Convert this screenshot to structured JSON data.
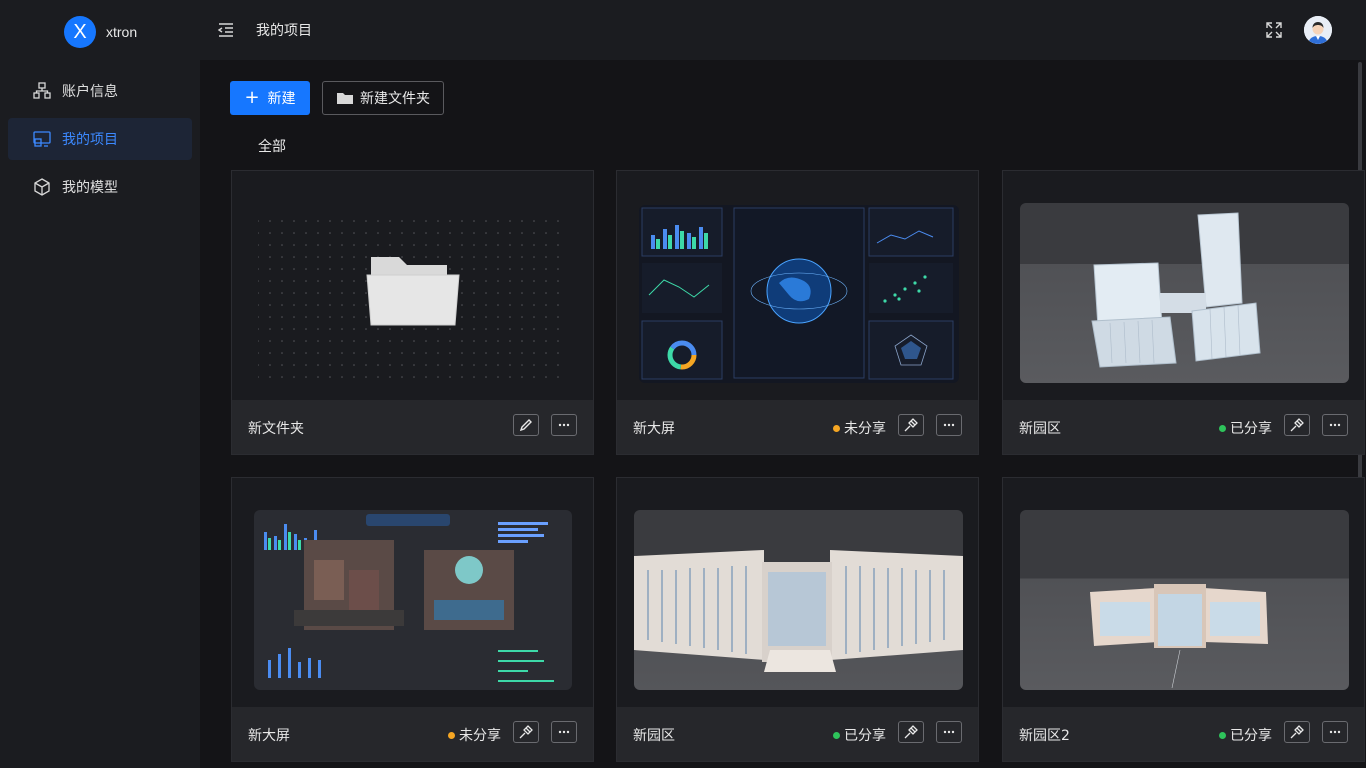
{
  "app": {
    "logo_letter": "X",
    "name": "xtron"
  },
  "sidebar": {
    "items": [
      {
        "label": "账户信息",
        "icon": "account-tree-icon",
        "active": false
      },
      {
        "label": "我的项目",
        "icon": "project-screen-icon",
        "active": true
      },
      {
        "label": "我的模型",
        "icon": "cube-icon",
        "active": false
      }
    ]
  },
  "header": {
    "title": "我的项目"
  },
  "toolbar": {
    "new_label": "新建",
    "new_folder_label": "新建文件夹"
  },
  "filter": {
    "all_label": "全部"
  },
  "cards": [
    {
      "name": "新文件夹",
      "type": "folder",
      "status": "",
      "actions": [
        "edit-icon",
        "more-icon"
      ]
    },
    {
      "name": "新大屏",
      "type": "dashboard",
      "status": "未分享",
      "status_color": "#f5a623",
      "actions": [
        "hammer-icon",
        "more-icon"
      ]
    },
    {
      "name": "新园区",
      "type": "building",
      "status": "已分享",
      "status_color": "#2ec35b",
      "actions": [
        "hammer-icon",
        "more-icon"
      ]
    },
    {
      "name": "新大屏",
      "type": "dashboard-city",
      "status": "未分享",
      "status_color": "#f5a623",
      "actions": [
        "hammer-icon",
        "more-icon"
      ]
    },
    {
      "name": "新园区",
      "type": "office-building",
      "status": "已分享",
      "status_color": "#2ec35b",
      "actions": [
        "hammer-icon",
        "more-icon"
      ]
    },
    {
      "name": "新园区2",
      "type": "low-building",
      "status": "已分享",
      "status_color": "#2ec35b",
      "actions": [
        "hammer-icon",
        "more-icon"
      ]
    }
  ]
}
